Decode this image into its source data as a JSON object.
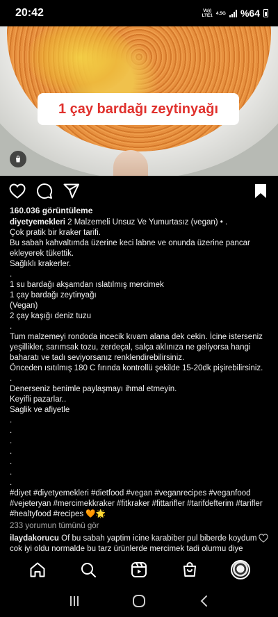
{
  "status_bar": {
    "time": "20:42",
    "network_top": "Vo))",
    "network_bottom": "LTE1",
    "network_gen": "4.5G",
    "battery": "%64"
  },
  "post": {
    "overlay_caption": "1 çay bardağı zeytinyağı",
    "views": "160.036 görüntüleme",
    "username": "diyetyemekleri",
    "caption": " 2 Malzemeli Unsuz Ve Yumurtasız (vegan) • .\nÇok pratik bir kraker tarifi.\nBu sabah kahvaltımda üzerine keci labne ve onunda üzerine pancar ekleyerek tükettik.\nSağlıklı krakerler.\n.\n1 su bardağı akşamdan ıslatılmış mercimek\n1 çay bardağı zeytinyağı\n(Vegan)\n2 çay kaşığı deniz tuzu\n.\nTum malzemeyi rondoda incecik kıvam alana dek cekin. İcine isterseniz yeşillikler, sarımsak tozu, zerdeçal, salça aklınıza ne geliyorsa hangi baharatı ve tadı seviyorsanız renklendirebilirsiniz.\nÖnceden ısıtılmış 180 C fırında kontrollü şekilde 15-20dk pişirebilirsiniz.\n.\nDenerseniz benimle paylaşmayı ihmal etmeyin.\nKeyifli pazarlar..\nSaglik ve afiyetle\n.\n.\n.\n.\n.\n.\n.\n#diyet #diyetyemekleri #dietfood #vegan #veganrecipes #veganfood #vejeteryan #mercimekkraker #fitkraker #fittarifler #tarifdefterim #tarifler #healtyfood #recipes 🧡🌟",
    "comments_link": "233 yorumun tümünü gör"
  },
  "comment": {
    "username": "ilaydakorucu",
    "text": " Of bu sabah yaptim icine karabiber pul biberde koydum cok iyi oldu normalde bu tarz ürünlerde mercimek tadi olurmu diye şüphe"
  },
  "icons": {
    "like": "heart-icon",
    "comment": "comment-icon",
    "share": "send-icon",
    "save": "bookmark-icon",
    "nav": [
      "home-icon",
      "search-icon",
      "reels-icon",
      "shop-icon",
      "profile-avatar"
    ],
    "system": [
      "recents-icon",
      "home-circle-icon",
      "back-icon"
    ]
  },
  "colors": {
    "background": "#000000",
    "text": "#f5f5f5",
    "muted": "#a8a8a8",
    "overlay_text": "#e0312d"
  }
}
